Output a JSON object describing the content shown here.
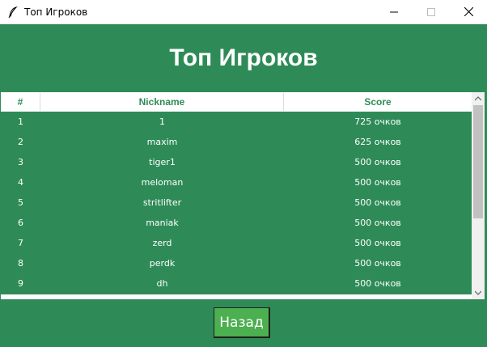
{
  "window": {
    "title": "Топ Игроков",
    "icon": "feather-icon"
  },
  "heading": "Топ Игроков",
  "table": {
    "columns": [
      "#",
      "Nickname",
      "Score"
    ],
    "rows": [
      {
        "rank": "1",
        "nickname": "1",
        "score": "725 очков"
      },
      {
        "rank": "2",
        "nickname": "maxim",
        "score": "625 очков"
      },
      {
        "rank": "3",
        "nickname": "tiger1",
        "score": "500 очков"
      },
      {
        "rank": "4",
        "nickname": "meloman",
        "score": "500 очков"
      },
      {
        "rank": "5",
        "nickname": "stritlifter",
        "score": "500 очков"
      },
      {
        "rank": "6",
        "nickname": "maniak",
        "score": "500 очков"
      },
      {
        "rank": "7",
        "nickname": "zerd",
        "score": "500 очков"
      },
      {
        "rank": "8",
        "nickname": "perdk",
        "score": "500 очков"
      },
      {
        "rank": "9",
        "nickname": "dh",
        "score": "500 очков"
      }
    ]
  },
  "back_button": "Назад",
  "colors": {
    "background": "#2e8b57",
    "header_text": "#2e8b57",
    "button": "#4caf50"
  }
}
